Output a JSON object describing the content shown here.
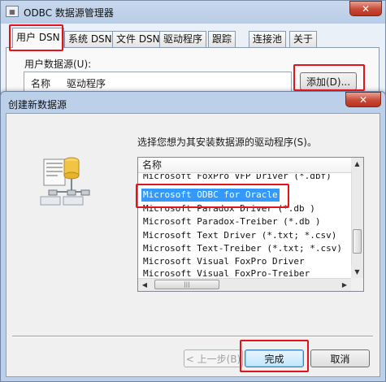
{
  "background_window": {
    "title": "ODBC 数据源管理器",
    "app_icon": "odbc-window-icon",
    "close_glyph": "✕",
    "tabs": [
      {
        "label": "用户 DSN",
        "active": true
      },
      {
        "label": "系统 DSN",
        "active": false
      },
      {
        "label": "文件 DSN",
        "active": false
      },
      {
        "label": "驱动程序",
        "active": false
      },
      {
        "label": "跟踪",
        "active": false
      },
      {
        "label": "连接池",
        "active": false
      },
      {
        "label": "关于",
        "active": false
      }
    ],
    "user_dsn_label": "用户数据源(U):",
    "list_columns": [
      "名称",
      "驱动程序"
    ],
    "add_button": "添加(D)..."
  },
  "dialog": {
    "title": "创建新数据源",
    "close_glyph": "✕",
    "prompt": "选择您想为其安装数据源的驱动程序(S)。",
    "illustration_icon": "data-source-illustration-icon",
    "driver_list": {
      "header": "名称",
      "items": [
        {
          "label": "Microsoft FoxPro VFP Driver (*.dbf)",
          "selected": false
        },
        {
          "label": "Microsoft ODBC for Oracle",
          "selected": true
        },
        {
          "label": "Microsoft Paradox Driver (*.db )",
          "selected": false
        },
        {
          "label": "Microsoft Paradox-Treiber (*.db )",
          "selected": false
        },
        {
          "label": "Microsoft Text Driver (*.txt; *.csv)",
          "selected": false
        },
        {
          "label": "Microsoft Text-Treiber (*.txt; *.csv)",
          "selected": false
        },
        {
          "label": "Microsoft Visual FoxPro Driver",
          "selected": false
        },
        {
          "label": "Microsoft Visual FoxPro-Treiber",
          "selected": false
        }
      ]
    },
    "buttons": {
      "back": "< 上一步(B)",
      "finish": "完成",
      "cancel": "取消"
    }
  },
  "colors": {
    "highlight_box": "#e3121b",
    "selection": "#3399ff"
  }
}
